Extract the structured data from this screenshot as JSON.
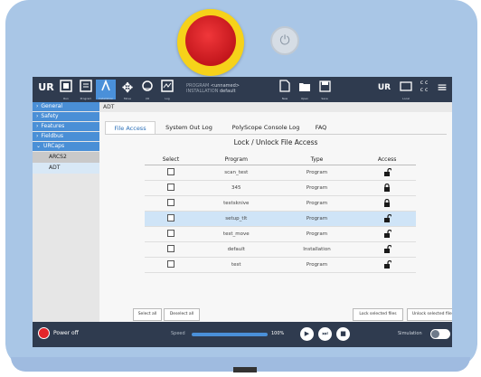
{
  "topbar": {
    "program_label": "PROGRAM",
    "program_value": "<unnamed>",
    "installation_label": "INSTALLATION",
    "installation_value": "default",
    "icons": [
      {
        "name": "ur-logo-icon",
        "label": ""
      },
      {
        "name": "run-icon",
        "label": "Run"
      },
      {
        "name": "program-icon",
        "label": "Program"
      },
      {
        "name": "installation-icon",
        "label": "Installation"
      },
      {
        "name": "move-icon",
        "label": "Move"
      },
      {
        "name": "io-icon",
        "label": "I/O"
      },
      {
        "name": "log-icon",
        "label": "Log"
      }
    ],
    "file_buttons": [
      "New",
      "Open",
      "Save"
    ],
    "right_icons": [
      "remote-control-icon",
      "local-icon",
      "cc-icon",
      "hamburger-menu-icon"
    ],
    "local_label": "Local"
  },
  "sidebar": {
    "items": [
      {
        "label": "General"
      },
      {
        "label": "Safety"
      },
      {
        "label": "Features"
      },
      {
        "label": "Fieldbus"
      },
      {
        "label": "URCaps"
      }
    ],
    "subitems": [
      {
        "label": "ARCS2"
      },
      {
        "label": "ADT"
      }
    ]
  },
  "breadcrumb": "ADT",
  "tabs": [
    {
      "label": "File Access"
    },
    {
      "label": "System Out Log"
    },
    {
      "label": "PolyScope Console Log"
    },
    {
      "label": "FAQ"
    }
  ],
  "heading": "Lock / Unlock File Access",
  "table": {
    "headers": [
      "Select",
      "Program",
      "Type",
      "Access"
    ],
    "rows": [
      {
        "program": "scan_test",
        "type": "Program",
        "locked": false
      },
      {
        "program": "345",
        "type": "Program",
        "locked": true
      },
      {
        "program": "testsknive",
        "type": "Program",
        "locked": true
      },
      {
        "program": "setup_tlt",
        "type": "Program",
        "locked": false
      },
      {
        "program": "test_move",
        "type": "Program",
        "locked": false
      },
      {
        "program": "default",
        "type": "Installation",
        "locked": false
      },
      {
        "program": "test",
        "type": "Program",
        "locked": false
      }
    ]
  },
  "buttons": {
    "select_all": "Select all",
    "deselect_all": "Deselect all",
    "lock_selected": "Lock selected files",
    "unlock_selected": "Unlock selected files"
  },
  "footer": {
    "power_off": "Power off",
    "speed_label": "Speed",
    "speed_value": "100%",
    "simulation_label": "Simulation"
  },
  "colors": {
    "topbar": "#2f3b4f",
    "accent": "#4a90d9",
    "estop": "#d11f24",
    "estop_ring": "#f6d21a",
    "pendant": "#a9c6e6"
  }
}
